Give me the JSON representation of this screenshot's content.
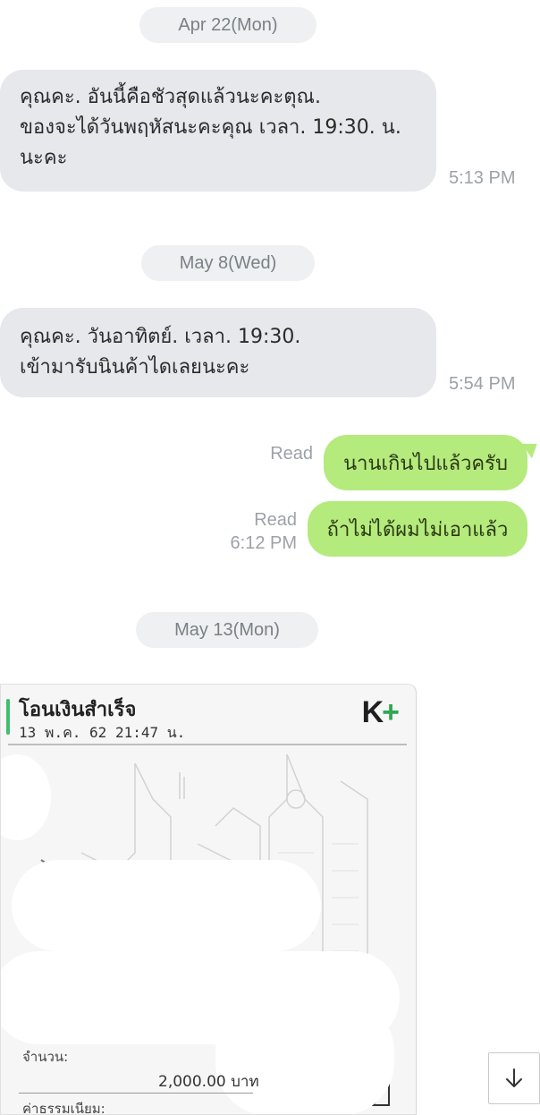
{
  "dates": {
    "d1": "Apr 22(Mon)",
    "d2": "May 8(Wed)",
    "d3": "May 13(Mon)"
  },
  "incoming": [
    {
      "lines": [
        "คุณคะ. อันนี้คือชัวสุดแล้วนะคะตุณ.",
        "ของจะได้วันพฤหัสนะคะคุณ เวลา. 19:30. น.",
        "นะคะ"
      ],
      "time": "5:13 PM"
    },
    {
      "lines": [
        "คุณคะ. วันอาทิตย์.  เวลา. 19:30.",
        "เข้ามารับนินค้าไดเลยนะคะ"
      ],
      "time": "5:54 PM"
    }
  ],
  "outgoing": [
    {
      "text": "นานเกินไปแล้วครับ",
      "read": "Read"
    },
    {
      "text": "ถ้าไม่ได้ผมไม่เอาแล้ว",
      "read": "Read",
      "time": "6:12 PM"
    }
  ],
  "slip": {
    "title": "โอนเงินสำเร็จ",
    "date": "13 พ.ค. 62  21:47 น.",
    "logo_k": "K",
    "logo_plus": "+",
    "amount_label": "จำนวน:",
    "amount_value": "2,000.00 บาท",
    "fee_label": "ค่าธรรมเนียม:"
  },
  "colors": {
    "outgoing_bubble": "#b5ea7d",
    "incoming_bubble": "#e6e8eb",
    "date_pill": "#eef0f2",
    "brand_green": "#3fbf6f"
  },
  "icons": {
    "scroll_down": "arrow-down-icon"
  }
}
